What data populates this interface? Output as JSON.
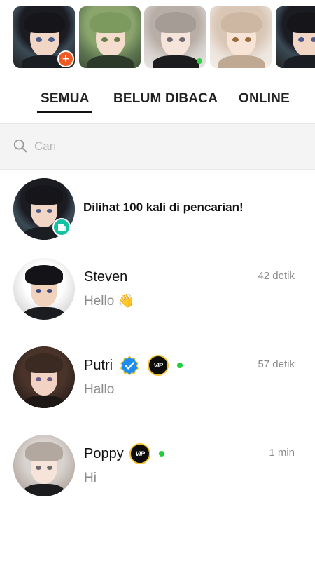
{
  "stories": [
    {
      "name": "story-1",
      "badge": "+"
    },
    {
      "name": "story-2"
    },
    {
      "name": "story-3",
      "online": true
    },
    {
      "name": "story-4"
    },
    {
      "name": "story-5"
    }
  ],
  "tabs": {
    "all": "SEMUA",
    "unread": "BELUM DIBACA",
    "online": "ONLINE"
  },
  "search": {
    "placeholder": "Cari"
  },
  "promo": {
    "text": "Dilihat 100 kali di pencarian!"
  },
  "chats": [
    {
      "name": "Steven",
      "message": "Hello 👋",
      "time": "42 detik"
    },
    {
      "name": "Putri",
      "message": "Hallo",
      "time": "57 detik",
      "verified": true,
      "vip": true,
      "online": true
    },
    {
      "name": "Poppy",
      "message": "Hi",
      "time": "1 min",
      "vip": true,
      "online": true
    }
  ],
  "badges": {
    "vip_label": "VIP"
  },
  "colors": {
    "accent_orange": "#f05a22",
    "online_green": "#1fcf3a",
    "verified_blue": "#1d8cf0",
    "search_teal": "#13c2a3",
    "vip_gold": "#f3c233"
  }
}
